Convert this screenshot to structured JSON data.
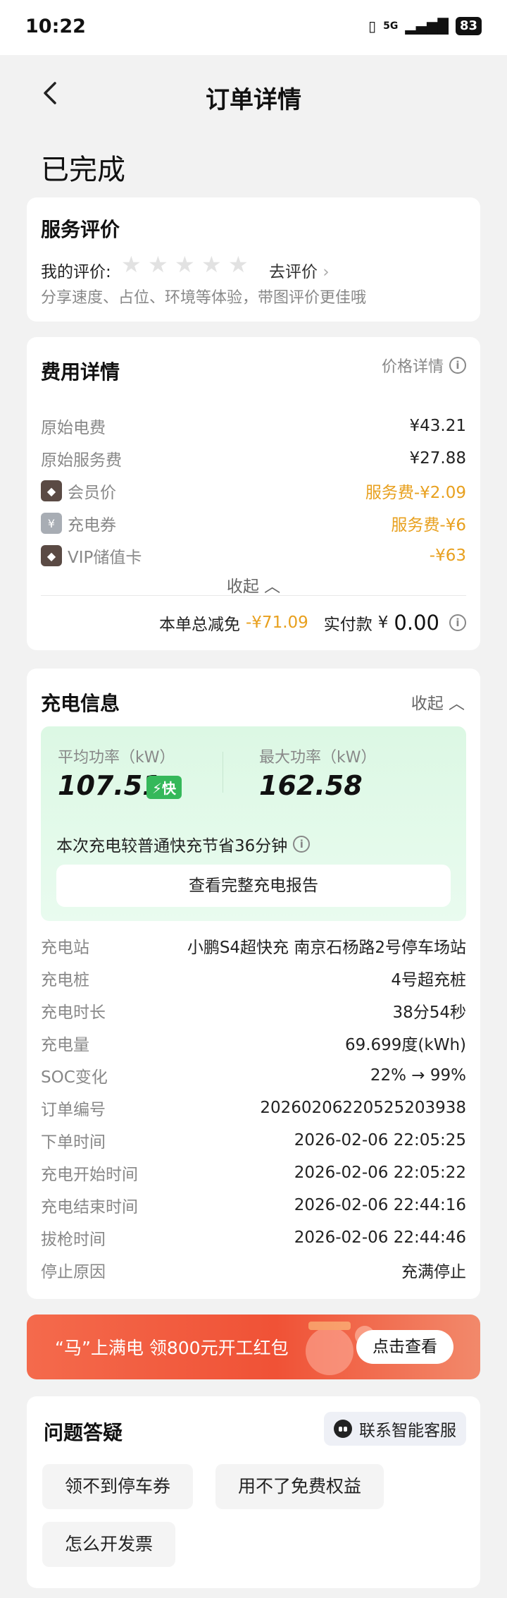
{
  "status_bar": {
    "time": "10:22",
    "network": "5G",
    "battery": "83"
  },
  "header": {
    "title": "订单详情"
  },
  "order_status": "已完成",
  "review": {
    "title": "服务评价",
    "my_rating_label": "我的评价:",
    "stars": 0,
    "go_review": "去评价",
    "hint": "分享速度、占位、环境等体验，带图评价更佳哦"
  },
  "fees": {
    "title": "费用详情",
    "price_detail": "价格详情",
    "rows": [
      {
        "label": "原始电费",
        "value": "¥43.21"
      },
      {
        "label": "原始服务费",
        "value": "¥27.88"
      },
      {
        "label": "会员价",
        "value": "服务费-¥2.09"
      },
      {
        "label": "充电券",
        "value": "服务费-¥6"
      },
      {
        "label": "VIP储值卡",
        "value": "-¥63"
      }
    ],
    "collapse_label": "收起",
    "total_discount_label": "本单总减免",
    "total_discount_value": "-¥71.09",
    "paid_label": "实付款",
    "paid_currency": "¥",
    "paid_value": "0.00"
  },
  "charge": {
    "title": "充电信息",
    "collapse_label": "收起",
    "avg_power_label": "平均功率（kW）",
    "avg_power_value": "107.51",
    "fast_badge": "快",
    "max_power_label": "最大功率（kW）",
    "max_power_value": "162.58",
    "save_note": "本次充电较普通快充节省36分钟",
    "report_button": "查看完整充电报告",
    "rows": [
      {
        "label": "充电站",
        "value": "小鹏S4超快充 南京石杨路2号停车场站"
      },
      {
        "label": "充电桩",
        "value": "4号超充桩"
      },
      {
        "label": "充电时长",
        "value": "38分54秒"
      },
      {
        "label": "充电量",
        "value": "69.699度(kWh)"
      },
      {
        "label": "SOC变化",
        "value": "22% → 99%"
      },
      {
        "label": "订单编号",
        "value": "20260206220525203938"
      },
      {
        "label": "下单时间",
        "value": "2026-02-06 22:05:25"
      },
      {
        "label": "充电开始时间",
        "value": "2026-02-06 22:05:22"
      },
      {
        "label": "充电结束时间",
        "value": "2026-02-06 22:44:16"
      },
      {
        "label": "拔枪时间",
        "value": "2026-02-06 22:44:46"
      },
      {
        "label": "停止原因",
        "value": "充满停止"
      }
    ]
  },
  "banner": {
    "text": "“马”上满电 领800元开工红包",
    "button": "点击查看"
  },
  "faq": {
    "title": "问题答疑",
    "cs_button": "联系智能客服",
    "chips": [
      "领不到停车券",
      "用不了免费权益",
      "怎么开发票"
    ]
  },
  "colors": {
    "accent_orange": "#e8a01e",
    "fast_green": "#35b85a",
    "banner_red": "#f05236"
  }
}
